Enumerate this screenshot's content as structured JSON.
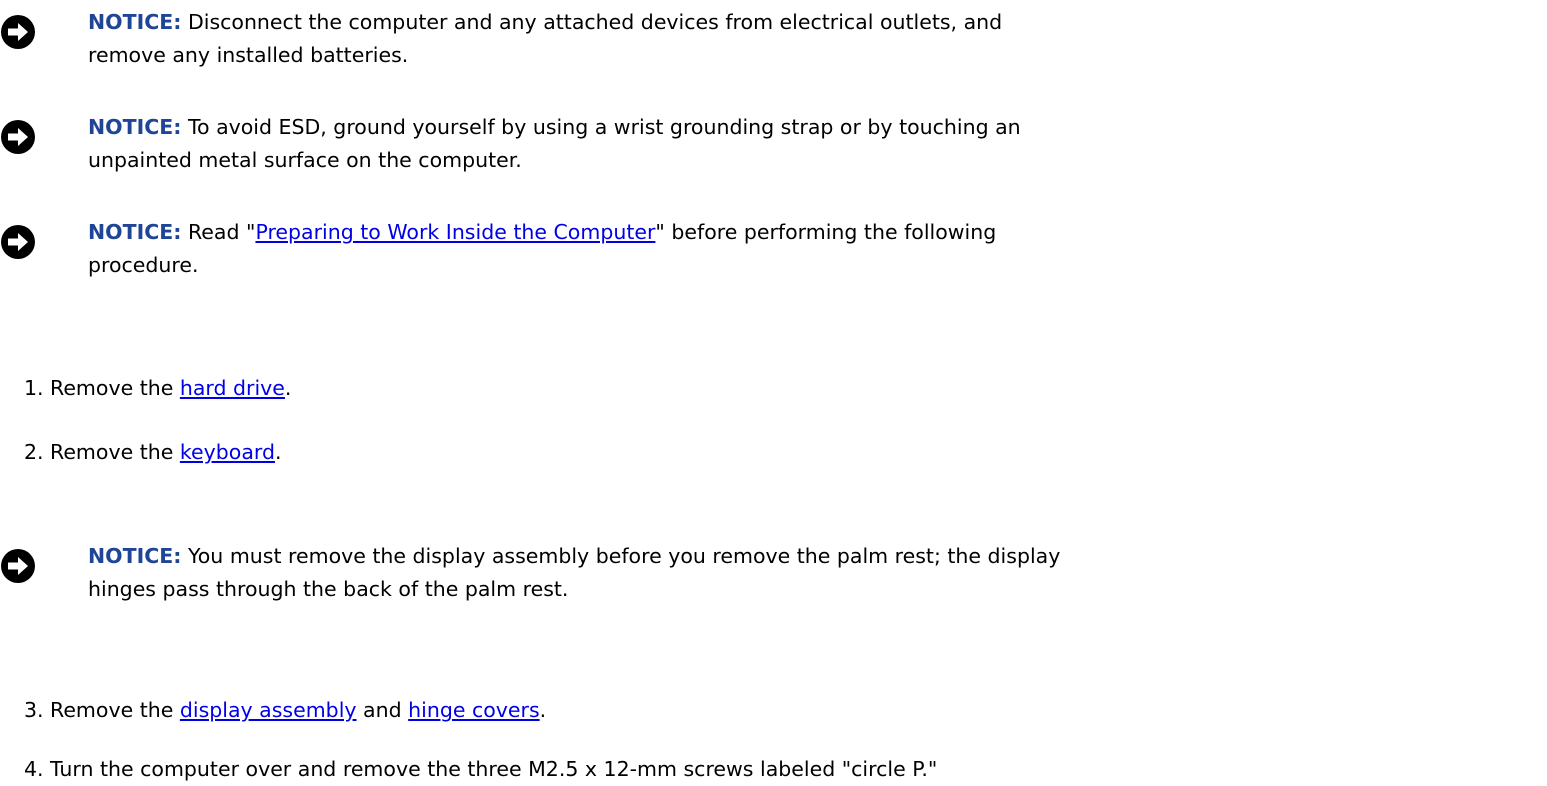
{
  "notices": [
    {
      "label": "NOTICE:",
      "line1": " Disconnect the computer and any attached devices from electrical outlets, and",
      "line2": "remove any installed batteries."
    },
    {
      "label": "NOTICE:",
      "line1": " To avoid ESD, ground yourself by using a wrist grounding strap or by touching an",
      "line2": "unpainted metal surface on the computer."
    },
    {
      "label": "NOTICE:",
      "pre_link": " Read \"",
      "link": "Preparing to Work Inside the Computer",
      "post_link": "\" before performing the following",
      "line2": "procedure."
    },
    {
      "label": "NOTICE:",
      "line1": " You must remove the display assembly before you remove the palm rest; the display",
      "line2": "hinges pass through the back of the palm rest."
    }
  ],
  "steps": [
    {
      "num": "1.",
      "pre": "Remove the ",
      "link": "hard drive",
      "post": "."
    },
    {
      "num": "2.",
      "pre": "Remove the ",
      "link": "keyboard",
      "post": "."
    },
    {
      "num": "3.",
      "pre": "Remove the ",
      "link": "display assembly",
      "mid": " and ",
      "link2": "hinge covers",
      "post": "."
    },
    {
      "num": "4.",
      "text": "Turn the computer over and remove the three M2.5 x 12-mm screws labeled \"circle P.\""
    }
  ],
  "icon": "notice-arrow-icon"
}
